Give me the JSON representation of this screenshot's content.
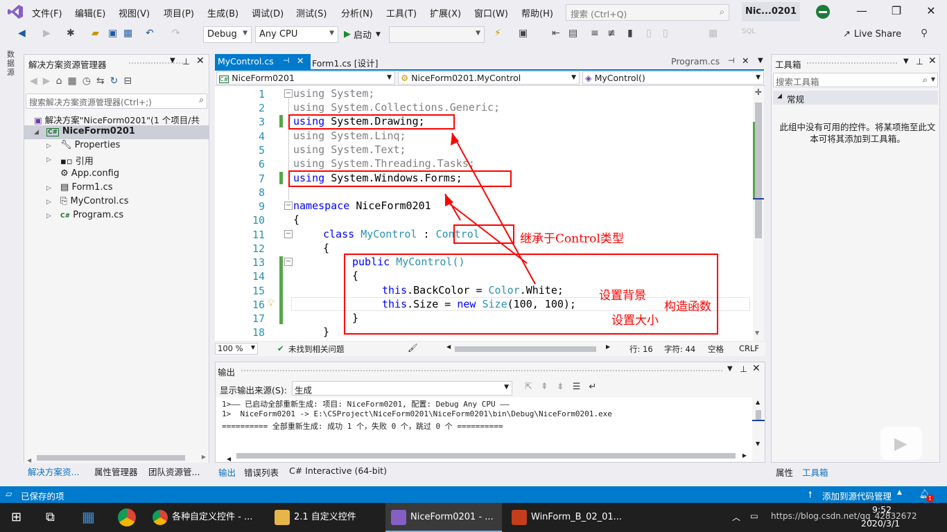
{
  "colors": {
    "accent": "#007acc",
    "annotation": "#ff0000",
    "keyword": "#0000ff",
    "type": "#2b91af",
    "grey": "#808080"
  },
  "menubar": {
    "items": [
      "文件(F)",
      "编辑(E)",
      "视图(V)",
      "项目(P)",
      "生成(B)",
      "调试(D)",
      "测试(S)",
      "分析(N)",
      "工具(T)",
      "扩展(X)",
      "窗口(W)",
      "帮助(H)"
    ],
    "search_placeholder": "搜索 (Ctrl+Q)",
    "profile": "Nic...0201"
  },
  "toolbar": {
    "config": "Debug",
    "platform": "Any CPU",
    "start": "启动",
    "live_share": "Live Share"
  },
  "left_strip": {
    "label": "数据源"
  },
  "solution_explorer": {
    "title": "解决方案资源管理器",
    "search_placeholder": "搜索解决方案资源管理器(Ctrl+;)",
    "solution": "解决方案\"NiceForm0201\"(1 个项目/共",
    "project": "NiceForm0201",
    "items": [
      "Properties",
      "引用",
      "App.config",
      "Form1.cs",
      "MyControl.cs",
      "Program.cs"
    ],
    "bottom_tabs": [
      "解决方案资...",
      "属性管理器",
      "团队资源管..."
    ]
  },
  "editor": {
    "tabs": [
      "MyControl.cs",
      "Form1.cs [设计]"
    ],
    "right_tab": "Program.cs",
    "nav": [
      "NiceForm0201",
      "NiceForm0201.MyControl",
      "MyControl()"
    ],
    "lines": [
      "1",
      "2",
      "3",
      "4",
      "5",
      "6",
      "7",
      "8",
      "9",
      "10",
      "11",
      "12",
      "13",
      "14",
      "15",
      "16",
      "17",
      "18"
    ],
    "zoom": "100 %",
    "issues": "未找到相关问题",
    "pos": {
      "line": "行: 16",
      "col": "字符: 44",
      "space": "空格",
      "eol": "CRLF"
    }
  },
  "code": {
    "using": "using",
    "system": "System;",
    "generic": "System.Collections.Generic;",
    "drawing": "System.Drawing;",
    "linq": "System.Linq;",
    "text": "System.Text;",
    "tasks": "System.Threading.Tasks;",
    "forms": "System.Windows.Forms;",
    "namespace": "namespace",
    "ns_name": "NiceForm0201",
    "brace_open": "{",
    "brace_close": "}",
    "class": "class",
    "class_name": "MyControl",
    "colon": ":",
    "base": "Control",
    "public": "public",
    "ctor": "MyControl()",
    "this1": "this",
    "backcolor": ".BackColor = ",
    "color": "Color",
    ".white": ".White;",
    "this2": "this",
    "size_a": ".Size = ",
    "new": "new",
    "size_t": "Size",
    "size_b": "(100, 100);"
  },
  "annotations": {
    "inherit": "继承于Control类型",
    "bg": "设置背景",
    "size": "设置大小",
    "ctor": "构造函数"
  },
  "toolbox": {
    "title": "工具箱",
    "search_placeholder": "搜索工具箱",
    "group": "常规",
    "empty_msg": "此组中没有可用的控件。将某项拖至此文本可将其添加到工具箱。",
    "bottom_tabs": [
      "属性",
      "工具箱"
    ]
  },
  "output": {
    "title": "输出",
    "source_label": "显示输出来源(S):",
    "source_value": "生成",
    "lines": [
      "1>—— 已启动全部重新生成: 项目: NiceForm0201, 配置: Debug Any CPU ——",
      "1>  NiceForm0201 -> E:\\CSProject\\NiceForm0201\\NiceForm0201\\bin\\Debug\\NiceForm0201.exe",
      "========== 全部重新生成: 成功 1 个，失败 0 个，跳过 0 个 =========="
    ],
    "bottom_tabs": [
      "输出",
      "错误列表",
      "C# Interactive (64-bit)"
    ]
  },
  "status": {
    "saved": "已保存的项",
    "source_control": "添加到源代码管理"
  },
  "taskbar": {
    "apps": [
      "各种自定义控件 - ...",
      "2.1 自定义控件",
      "NiceForm0201 - ...",
      "WinForm_B_02_01..."
    ],
    "time": "9:52",
    "date": "2020/3/1",
    "watermark": "https://blog.csdn.net/qq_42832672"
  }
}
